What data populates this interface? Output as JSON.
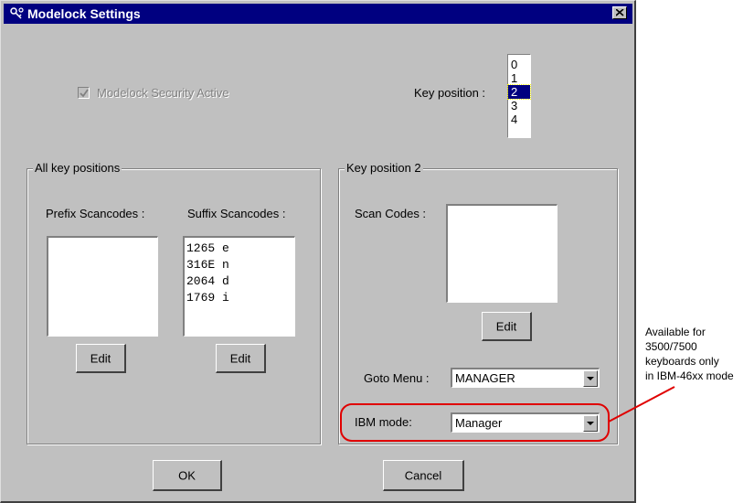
{
  "window": {
    "title": "Modelock Settings",
    "icon": "keys-icon",
    "close_icon": "close-icon"
  },
  "security": {
    "label": "Modelock Security Active",
    "checked": true,
    "enabled": false
  },
  "key_position": {
    "label": "Key position :",
    "options": [
      "0",
      "1",
      "2",
      "3",
      "4"
    ],
    "selected": "2"
  },
  "all_keys_group": {
    "title": "All key positions",
    "prefix_label": "Prefix Scancodes :",
    "suffix_label": "Suffix Scancodes :",
    "prefix_items": [],
    "suffix_items": [
      "1265 e",
      "316E n",
      "2064 d",
      "1769 i"
    ],
    "prefix_edit": "Edit",
    "suffix_edit": "Edit"
  },
  "key_pos_group": {
    "title": "Key position 2",
    "scan_codes_label": "Scan Codes :",
    "scan_codes_items": [],
    "edit": "Edit",
    "goto_menu_label": "Goto Menu :",
    "goto_menu_value": "MANAGER",
    "ibm_mode_label": "IBM mode:",
    "ibm_mode_value": "Manager"
  },
  "footer": {
    "ok": "OK",
    "cancel": "Cancel"
  },
  "annotation": {
    "lines": [
      "Available for",
      "3500/7500",
      "keyboards only",
      "in IBM-46xx mode"
    ],
    "highlight_color": "#e00000"
  }
}
